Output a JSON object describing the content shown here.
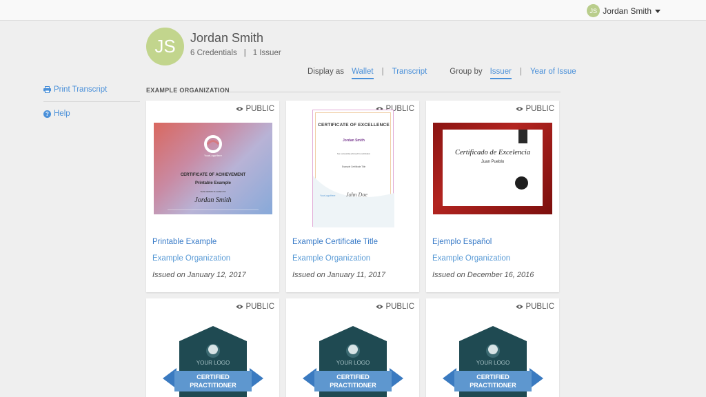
{
  "header": {
    "user_initials": "JS",
    "user_name": "Jordan Smith"
  },
  "profile": {
    "initials": "JS",
    "name": "Jordan Smith",
    "credentials": "6 Credentials",
    "separator": "|",
    "issuers": "1 Issuer"
  },
  "controls": {
    "display_as_label": "Display as",
    "wallet": "Wallet",
    "transcript": "Transcript",
    "group_by_label": "Group by",
    "issuer": "Issuer",
    "year_of_issue": "Year of Issue",
    "separator": "|"
  },
  "sidebar": {
    "print_transcript": "Print Transcript",
    "help": "Help",
    "help_icon_glyph": "?"
  },
  "section": {
    "title": "EXAMPLE ORGANIZATION"
  },
  "colors": {
    "accent": "#4a90d9",
    "avatar": "#c2d58d",
    "badge_dark": "#1f4a52",
    "ribbon": "#5e97cf"
  },
  "credentials": [
    {
      "visibility": "PUBLIC",
      "title": "Printable Example",
      "organization": "Example Organization",
      "issued": "Issued on January 12, 2017",
      "preview": {
        "org_name": "YourLogoHere",
        "heading": "CERTIFICATE OF ACHIEVEMENT",
        "subtitle": "Printable Example",
        "awarded_to": "THIS AWARD IS GIVEN TO",
        "recipient": "Jordan Smith"
      }
    },
    {
      "visibility": "PUBLIC",
      "title": "Example Certificate Title",
      "organization": "Example Organization",
      "issued": "Issued on January 11, 2017",
      "preview": {
        "heading": "CERTIFICATE OF EXCELLENCE",
        "recipient": "Jordan Smith",
        "body": "has successfully achieved the certification",
        "cert_title": "Example Certificate Title",
        "logo": "YourLogoHere",
        "signature": "John Doe"
      }
    },
    {
      "visibility": "PUBLIC",
      "title": "Ejemplo Español",
      "organization": "Example Organization",
      "issued": "Issued on December 16, 2016",
      "preview": {
        "heading": "Certificado de Excelencia",
        "recipient": "Juan Pueblo"
      }
    },
    {
      "visibility": "PUBLIC",
      "badge": {
        "logo": "YOUR LOGO",
        "line1": "CERTIFIED",
        "line2": "PRACTITIONER"
      }
    },
    {
      "visibility": "PUBLIC",
      "badge": {
        "logo": "YOUR LOGO",
        "line1": "CERTIFIED",
        "line2": "PRACTITIONER"
      }
    },
    {
      "visibility": "PUBLIC",
      "badge": {
        "logo": "YOUR LOGO",
        "line1": "CERTIFIED",
        "line2": "PRACTITIONER"
      }
    }
  ]
}
